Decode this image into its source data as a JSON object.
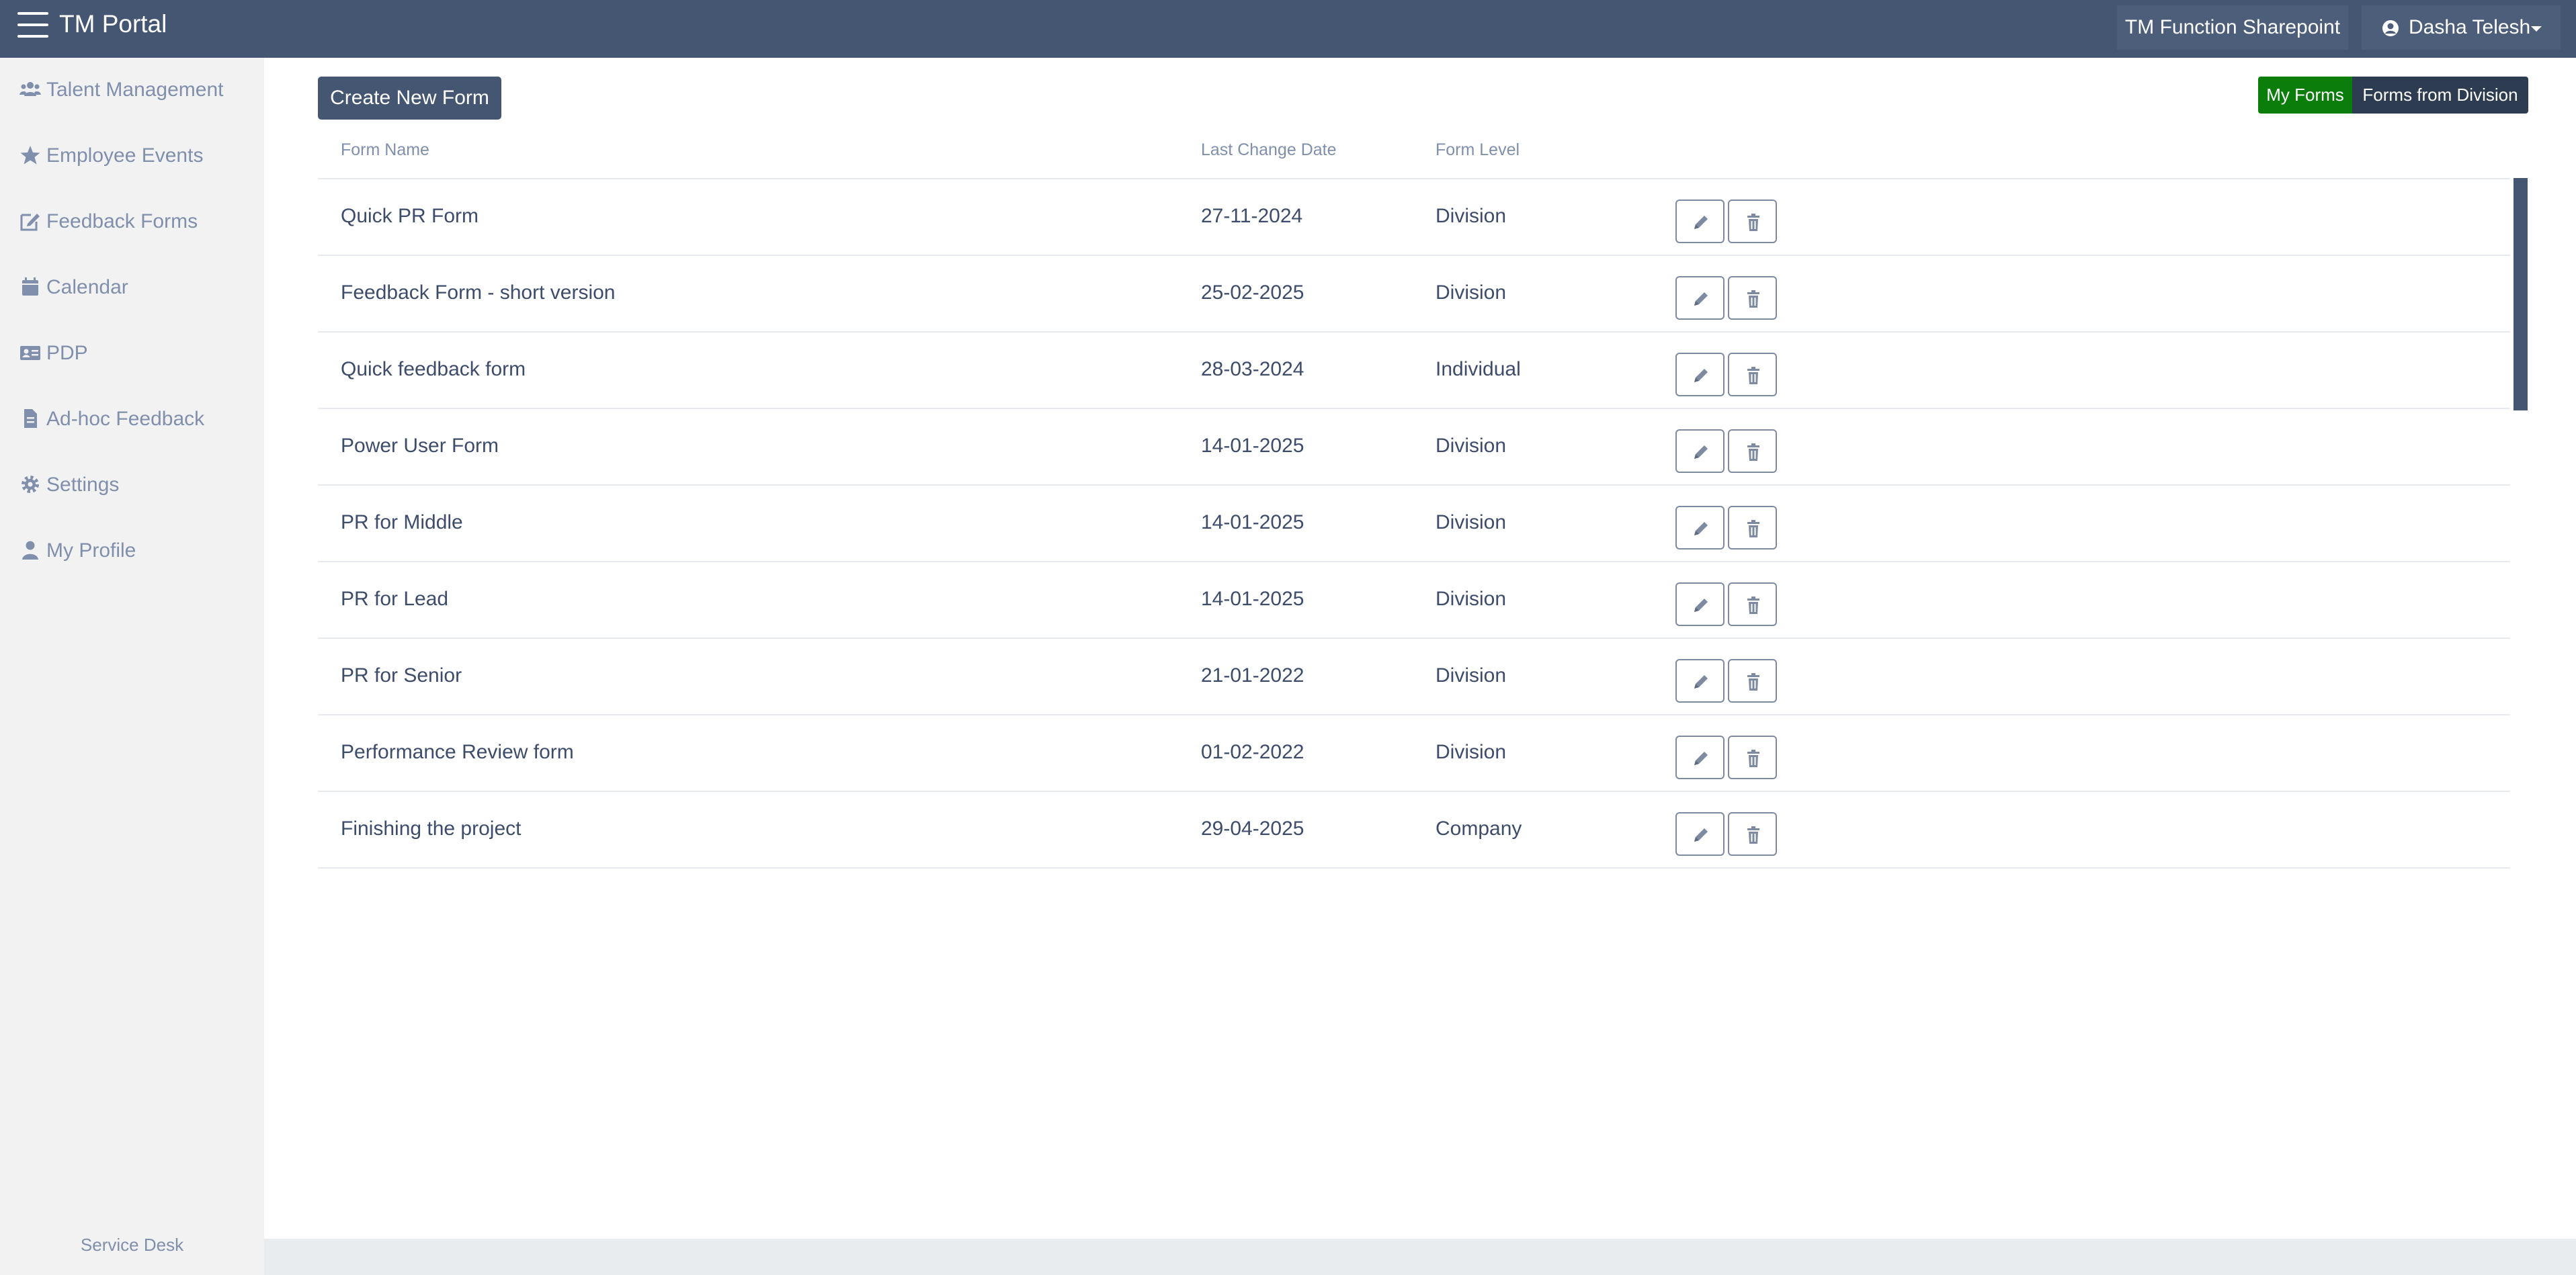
{
  "app": {
    "title": "TM Portal"
  },
  "header": {
    "link": "TM Function Sharepoint",
    "user": "Dasha Telesh"
  },
  "sidebar": {
    "items": [
      {
        "label": "Talent Management",
        "icon": "users-icon"
      },
      {
        "label": "Employee Events",
        "icon": "star-icon"
      },
      {
        "label": "Feedback Forms",
        "icon": "edit-form-icon"
      },
      {
        "label": "Calendar",
        "icon": "calendar-icon"
      },
      {
        "label": "PDP",
        "icon": "id-card-icon"
      },
      {
        "label": "Ad-hoc Feedback",
        "icon": "document-icon"
      },
      {
        "label": "Settings",
        "icon": "gear-icon"
      },
      {
        "label": "My Profile",
        "icon": "user-icon"
      }
    ],
    "footer": "Service Desk"
  },
  "toolbar": {
    "create_label": "Create New Form",
    "toggle": {
      "mine": "My Forms",
      "division": "Forms from Division",
      "active": "mine"
    }
  },
  "table": {
    "columns": [
      "Form Name",
      "Last Change Date",
      "Form Level"
    ],
    "rows": [
      {
        "name": "Quick PR Form",
        "date": "27-11-2024",
        "level": "Division"
      },
      {
        "name": "Feedback Form - short version",
        "date": "25-02-2025",
        "level": "Division"
      },
      {
        "name": "Quick feedback form",
        "date": "28-03-2024",
        "level": "Individual"
      },
      {
        "name": "Power User Form",
        "date": "14-01-2025",
        "level": "Division"
      },
      {
        "name": "PR for Middle",
        "date": "14-01-2025",
        "level": "Division"
      },
      {
        "name": "PR for Lead",
        "date": "14-01-2025",
        "level": "Division"
      },
      {
        "name": "PR for Senior",
        "date": "21-01-2022",
        "level": "Division"
      },
      {
        "name": "Performance Review form",
        "date": "01-02-2022",
        "level": "Division"
      },
      {
        "name": "Finishing the project",
        "date": "29-04-2025",
        "level": "Company"
      },
      {
        "name": "",
        "date": "",
        "level": ""
      }
    ]
  },
  "colors": {
    "header_bg": "#445672",
    "sidebar_bg": "#f2f2f3",
    "toggle_active": "#0a7d0a",
    "toggle_inactive": "#2e3c52"
  }
}
